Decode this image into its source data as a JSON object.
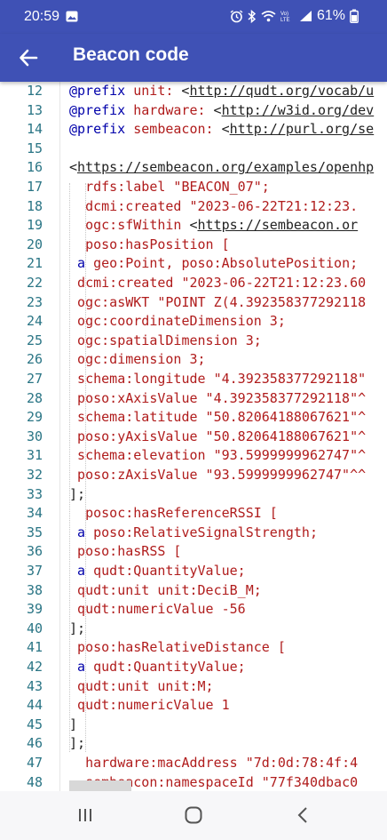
{
  "status_bar": {
    "time": "20:59",
    "battery_text": "61%",
    "icons": [
      "photo-icon",
      "alarm-icon",
      "bluetooth-icon",
      "wifi-icon",
      "volte-icon",
      "signal-icon",
      "battery-icon"
    ]
  },
  "app_bar": {
    "title": "Beacon code",
    "back_icon": "arrow-left-icon",
    "color": "#3f51b5"
  },
  "editor": {
    "lines": [
      {
        "n": "12",
        "indent": 0,
        "text": "@prefix unit: <http://qudt.org/vocab/u"
      },
      {
        "n": "13",
        "indent": 0,
        "text": "@prefix hardware: <http://w3id.org/dev"
      },
      {
        "n": "14",
        "indent": 0,
        "text": "@prefix sembeacon: <http://purl.org/se"
      },
      {
        "n": "15",
        "indent": 0,
        "text": ""
      },
      {
        "n": "16",
        "indent": 0,
        "text": "<https://sembeacon.org/examples/openhp"
      },
      {
        "n": "17",
        "indent": 2,
        "text": "rdfs:label \"BEACON_07\";"
      },
      {
        "n": "18",
        "indent": 2,
        "text": "dcmi:created \"2023-06-22T21:12:23."
      },
      {
        "n": "19",
        "indent": 2,
        "text": "ogc:sfWithin <https://sembeacon.or"
      },
      {
        "n": "20",
        "indent": 2,
        "text": "poso:hasPosition ["
      },
      {
        "n": "21",
        "indent": 1,
        "text": "a geo:Point, poso:AbsolutePosition;"
      },
      {
        "n": "22",
        "indent": 1,
        "text": "dcmi:created \"2023-06-22T21:12:23.60"
      },
      {
        "n": "23",
        "indent": 1,
        "text": "ogc:asWKT \"POINT Z(4.392358377292118"
      },
      {
        "n": "24",
        "indent": 1,
        "text": "ogc:coordinateDimension 3;"
      },
      {
        "n": "25",
        "indent": 1,
        "text": "ogc:spatialDimension 3;"
      },
      {
        "n": "26",
        "indent": 1,
        "text": "ogc:dimension 3;"
      },
      {
        "n": "27",
        "indent": 1,
        "text": "schema:longitude \"4.392358377292118\""
      },
      {
        "n": "28",
        "indent": 1,
        "text": "poso:xAxisValue \"4.392358377292118\"^"
      },
      {
        "n": "29",
        "indent": 1,
        "text": "schema:latitude \"50.82064188067621\"^"
      },
      {
        "n": "30",
        "indent": 1,
        "text": "poso:yAxisValue \"50.82064188067621\"^"
      },
      {
        "n": "31",
        "indent": 1,
        "text": "schema:elevation \"93.5999999962747\"^"
      },
      {
        "n": "32",
        "indent": 1,
        "text": "poso:zAxisValue \"93.5999999962747\"^^"
      },
      {
        "n": "33",
        "indent": 0,
        "text": "];"
      },
      {
        "n": "34",
        "indent": 2,
        "text": "posoc:hasReferenceRSSI ["
      },
      {
        "n": "35",
        "indent": 1,
        "text": "a poso:RelativeSignalStrength;"
      },
      {
        "n": "36",
        "indent": 1,
        "text": "poso:hasRSS ["
      },
      {
        "n": "37",
        "indent": 1,
        "text": "a qudt:QuantityValue;"
      },
      {
        "n": "38",
        "indent": 1,
        "text": "qudt:unit unit:DeciB_M;"
      },
      {
        "n": "39",
        "indent": 1,
        "text": "qudt:numericValue -56"
      },
      {
        "n": "40",
        "indent": 0,
        "text": "];"
      },
      {
        "n": "41",
        "indent": 1,
        "text": "poso:hasRelativeDistance ["
      },
      {
        "n": "42",
        "indent": 1,
        "text": "a qudt:QuantityValue;"
      },
      {
        "n": "43",
        "indent": 1,
        "text": "qudt:unit unit:M;"
      },
      {
        "n": "44",
        "indent": 1,
        "text": "qudt:numericValue 1"
      },
      {
        "n": "45",
        "indent": 0,
        "text": "]"
      },
      {
        "n": "46",
        "indent": 0,
        "text": "];"
      },
      {
        "n": "47",
        "indent": 2,
        "text": "hardware:macAddress \"7d:0d:78:4f:4"
      },
      {
        "n": "48",
        "indent": 2,
        "text": "sembeacon:namespaceId \"77f340dbac0"
      }
    ]
  },
  "nav_bar": {
    "buttons": [
      "recent-apps-icon",
      "home-icon",
      "back-chevron-icon"
    ]
  }
}
